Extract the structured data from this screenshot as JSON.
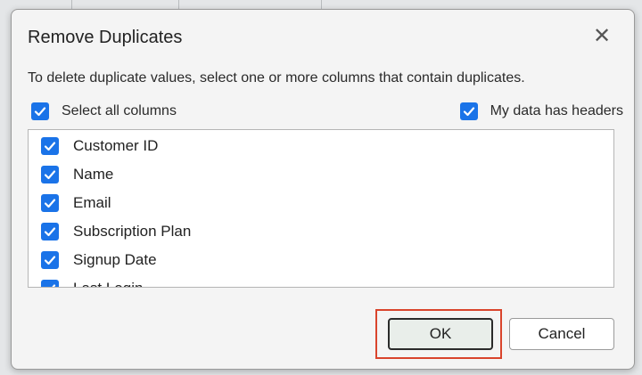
{
  "dialog": {
    "title": "Remove Duplicates",
    "instructions": "To delete duplicate values, select one or more columns that contain duplicates.",
    "select_all": {
      "label": "Select all columns",
      "checked": true
    },
    "has_headers": {
      "label": "My data has headers",
      "checked": true
    },
    "columns": [
      {
        "label": "Customer ID",
        "checked": true
      },
      {
        "label": "Name",
        "checked": true
      },
      {
        "label": "Email",
        "checked": true
      },
      {
        "label": "Subscription Plan",
        "checked": true
      },
      {
        "label": "Signup Date",
        "checked": true
      },
      {
        "label": "Last Login",
        "checked": true
      }
    ],
    "ok_label": "OK",
    "cancel_label": "Cancel",
    "close_icon": "close-icon",
    "accent_color": "#1a73e8",
    "highlight_color": "#d9442c"
  }
}
